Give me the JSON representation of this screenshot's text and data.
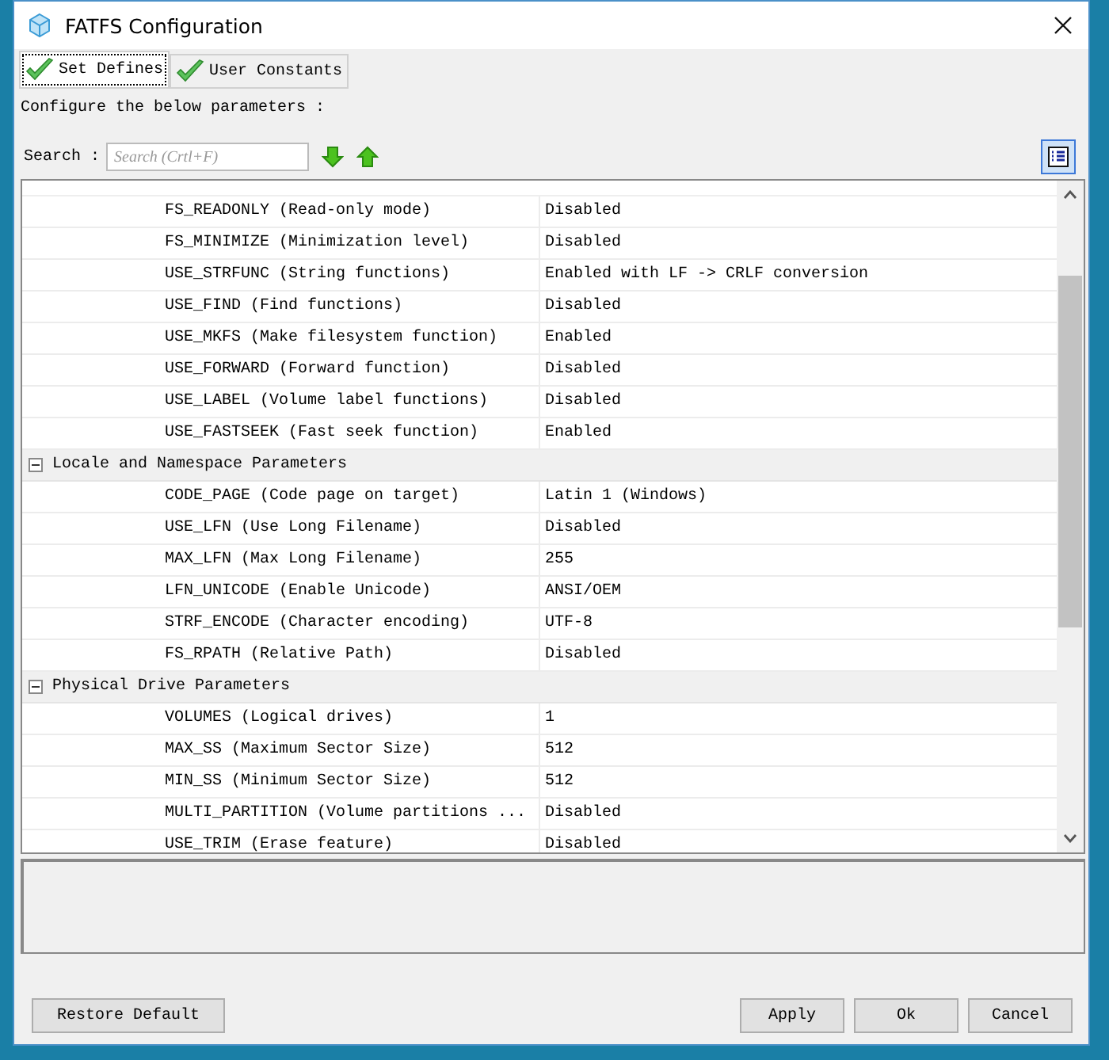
{
  "window": {
    "title": "FATFS Configuration"
  },
  "tabs": [
    {
      "label": "Set Defines",
      "selected": true
    },
    {
      "label": "User Constants",
      "selected": false
    }
  ],
  "intro": "Configure the below parameters :",
  "search": {
    "label": "Search :",
    "placeholder": "Search (Crtl+F)"
  },
  "groups": [
    {
      "params": [
        {
          "name": "FS_READONLY (Read-only mode)",
          "value": "Disabled"
        },
        {
          "name": "FS_MINIMIZE (Minimization level)",
          "value": "Disabled"
        },
        {
          "name": "USE_STRFUNC (String functions)",
          "value": "Enabled with LF -> CRLF conversion"
        },
        {
          "name": "USE_FIND (Find functions)",
          "value": "Disabled"
        },
        {
          "name": "USE_MKFS (Make filesystem function)",
          "value": "Enabled"
        },
        {
          "name": "USE_FORWARD (Forward function)",
          "value": "Disabled"
        },
        {
          "name": "USE_LABEL (Volume label functions)",
          "value": "Disabled"
        },
        {
          "name": "USE_FASTSEEK (Fast seek function)",
          "value": "Enabled"
        }
      ]
    },
    {
      "title": "Locale and Namespace Parameters",
      "expanded": true,
      "params": [
        {
          "name": "CODE_PAGE (Code page on target)",
          "value": "Latin 1 (Windows)"
        },
        {
          "name": "USE_LFN (Use Long Filename)",
          "value": "Disabled"
        },
        {
          "name": "MAX_LFN (Max Long Filename)",
          "value": "255"
        },
        {
          "name": "LFN_UNICODE (Enable Unicode)",
          "value": "ANSI/OEM"
        },
        {
          "name": "STRF_ENCODE (Character encoding)",
          "value": "UTF-8"
        },
        {
          "name": "FS_RPATH (Relative Path)",
          "value": "Disabled"
        }
      ]
    },
    {
      "title": "Physical Drive Parameters",
      "expanded": true,
      "params": [
        {
          "name": "VOLUMES (Logical drives)",
          "value": "1"
        },
        {
          "name": "MAX_SS (Maximum Sector Size)",
          "value": "512"
        },
        {
          "name": "MIN_SS (Minimum Sector Size)",
          "value": "512"
        },
        {
          "name": "MULTI_PARTITION (Volume partitions ...",
          "value": "Disabled"
        },
        {
          "name": "USE_TRIM (Erase feature)",
          "value": "Disabled"
        }
      ]
    }
  ],
  "buttons": {
    "restore": "Restore Default",
    "actions": [
      "Apply",
      "Ok",
      "Cancel"
    ]
  }
}
